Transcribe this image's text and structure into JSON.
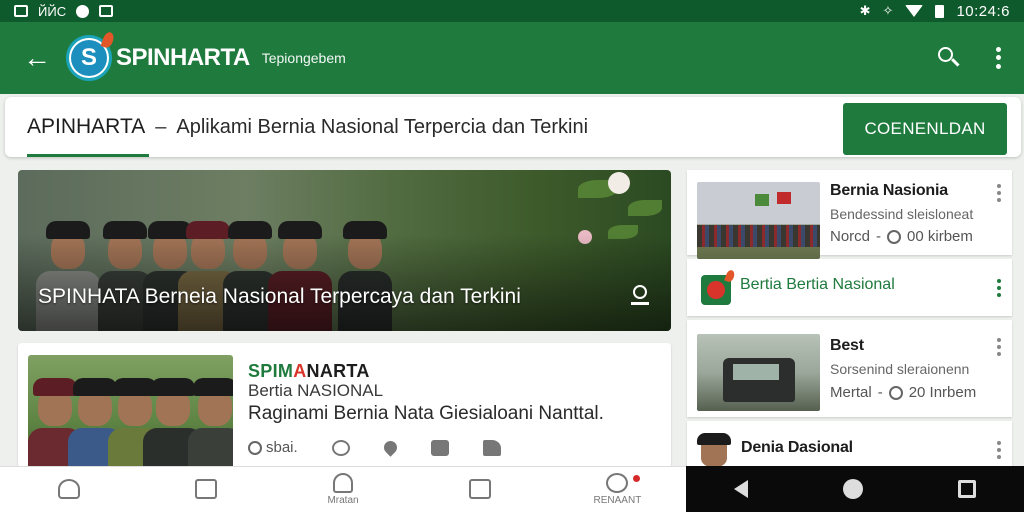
{
  "status_bar": {
    "left_text": "ЙЙС",
    "time": "10:24:6"
  },
  "app_bar": {
    "brand": "SPINHARTA",
    "subtitle": "Tepiongebem"
  },
  "header": {
    "app_name": "APINHARTA",
    "separator": "–",
    "tagline": "Aplikami Bernia Nasional Terpercia dan Terkini",
    "download_label": "COENENLDAN"
  },
  "hero": {
    "title": "SPINHATA  Berneia Nasional Terpercaya dan Terkini"
  },
  "feature": {
    "brand_green": "SPIM",
    "brand_red": "A",
    "brand_black": "NARTA",
    "subtitle": "Bertia NASIONAL",
    "text": "Raginami Bernia Nata Giesialoani Nanttal.",
    "time": "sbai."
  },
  "side_list": [
    {
      "title": "Bernia Nasionia",
      "desc": "Bendessind sleisloneat",
      "meta_left": "Norcd",
      "meta_sep": "-",
      "meta_time": "00 kirbem"
    },
    {
      "title": "Bertia Bertia Nasional"
    },
    {
      "title": "Best",
      "desc": "Sorsenind sleraionenn",
      "meta_left": "Mertal",
      "meta_sep": "-",
      "meta_time": "20 Inrbem"
    },
    {
      "title": "Denia Dasional"
    }
  ],
  "bottom_nav": {
    "items": [
      {
        "icon": "home-icon",
        "label": ""
      },
      {
        "icon": "square-icon",
        "label": ""
      },
      {
        "icon": "bell-icon",
        "label": "Mratan"
      },
      {
        "icon": "photo-icon",
        "label": ""
      },
      {
        "icon": "profile-icon",
        "label": "RENAANT"
      }
    ]
  },
  "colors": {
    "primary": "#1f7a3e",
    "status_bar": "#0f5a2c",
    "accent_red": "#d9342b"
  }
}
